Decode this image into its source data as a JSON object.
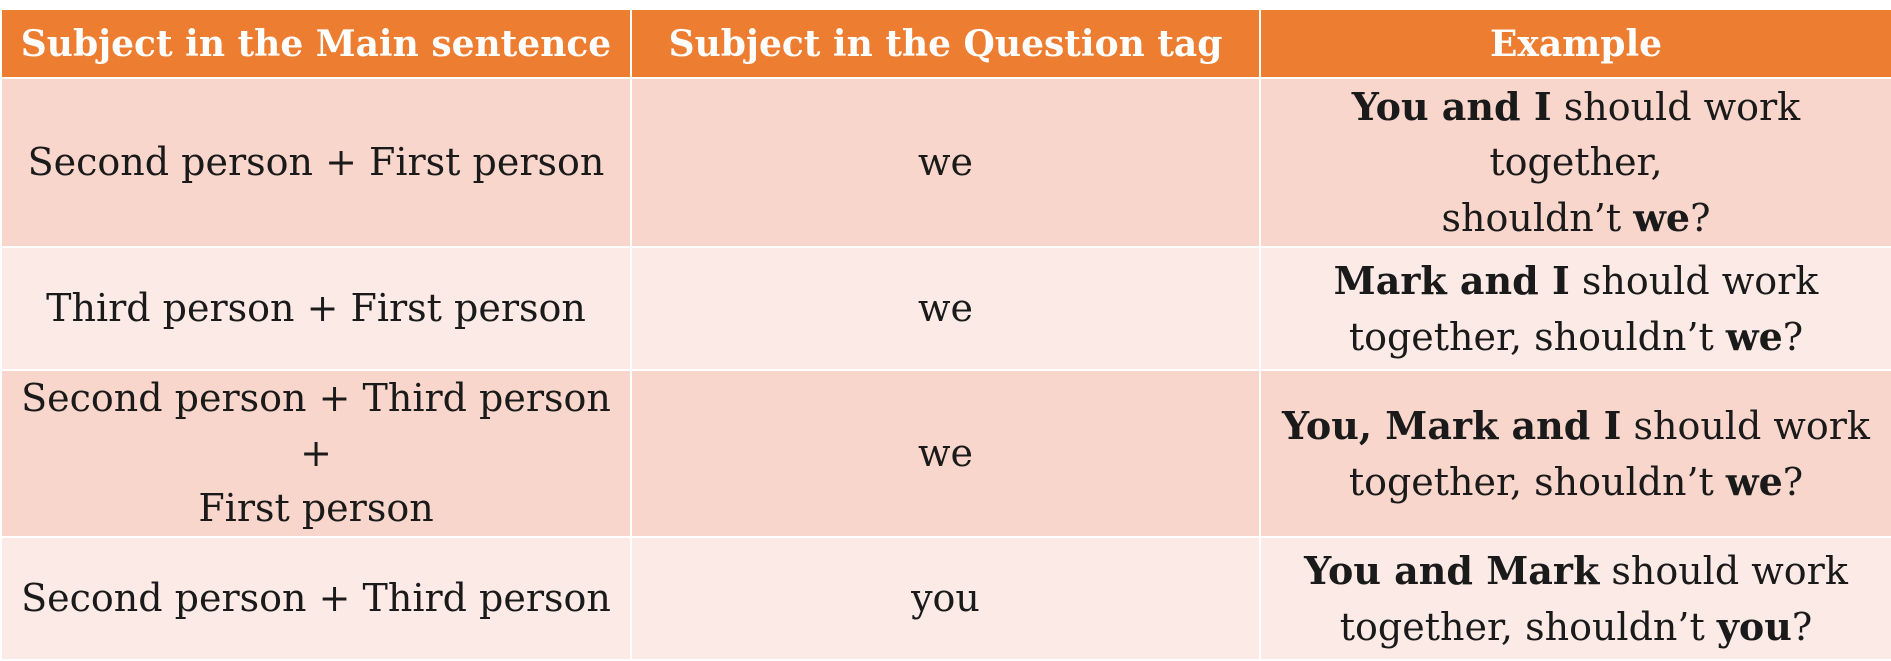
{
  "header": {
    "col1": "Subject in the Main sentence",
    "col2": "Subject in the Question tag",
    "col3": "Example"
  },
  "rows": [
    {
      "main_subject": [
        "Second person + First person"
      ],
      "tag_subject": "we",
      "example": [
        [
          {
            "t": "You and I",
            "b": true
          },
          {
            "t": " should work together,",
            "b": false
          }
        ],
        [
          {
            "t": "shouldn’t ",
            "b": false
          },
          {
            "t": "we",
            "b": true
          },
          {
            "t": "?",
            "b": false
          }
        ]
      ]
    },
    {
      "main_subject": [
        "Third person + First person"
      ],
      "tag_subject": "we",
      "example": [
        [
          {
            "t": "Mark and I",
            "b": true
          },
          {
            "t": " should work",
            "b": false
          }
        ],
        [
          {
            "t": "together, shouldn’t ",
            "b": false
          },
          {
            "t": "we",
            "b": true
          },
          {
            "t": "?",
            "b": false
          }
        ]
      ]
    },
    {
      "main_subject": [
        "Second person + Third person +",
        "First person"
      ],
      "tag_subject": "we",
      "example": [
        [
          {
            "t": "You, Mark and I",
            "b": true
          },
          {
            "t": " should work",
            "b": false
          }
        ],
        [
          {
            "t": "together, shouldn’t ",
            "b": false
          },
          {
            "t": "we",
            "b": true
          },
          {
            "t": "?",
            "b": false
          }
        ]
      ]
    },
    {
      "main_subject": [
        "Second person + Third person"
      ],
      "tag_subject": "you",
      "example": [
        [
          {
            "t": "You and Mark",
            "b": true
          },
          {
            "t": " should work",
            "b": false
          }
        ],
        [
          {
            "t": "together, shouldn’t ",
            "b": false
          },
          {
            "t": "you",
            "b": true
          },
          {
            "t": "?",
            "b": false
          }
        ]
      ]
    }
  ],
  "colors": {
    "header_bg": "#ed7d31",
    "row_odd_bg": "#f8d6cb",
    "row_even_bg": "#fbeae5"
  }
}
